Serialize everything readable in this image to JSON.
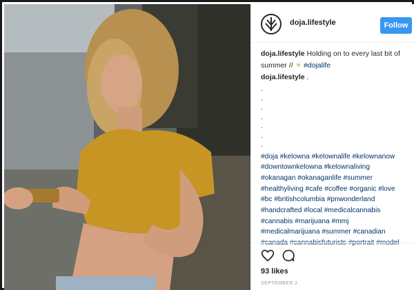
{
  "photo": {
    "description_icon": "photo"
  },
  "post": {
    "username": "doja.lifestyle",
    "follow_label": "Follow",
    "caption": {
      "user": "doja.lifestyle",
      "text_line1": "Holding on to every last bit of",
      "text_line2": "summer //",
      "emoji": "☀",
      "tag": "#dojalife"
    },
    "comment": {
      "user": "doja.lifestyle",
      "text": "."
    },
    "dots": [
      ".",
      ".",
      ".",
      ".",
      ".",
      ".",
      "."
    ],
    "hashtag_lines": [
      "#doja #kelowna #kelownalife #kelownanow",
      "#downtownkelowna #kelownaliving",
      "#okanagan #okanaganlife #summer",
      "#healthyliving #cafe #coffee #organic #love",
      "#bc #britishcolumbia #pnwonderland",
      "#handcrafted #local #medicalcannabis",
      "#cannabis #marijuana #mmj",
      "#medicalmarijuana #summer #canadian",
      "#canada #cannabisfuturists #portrait #model"
    ],
    "likes": "93 likes",
    "date": "SEPTEMBER 2",
    "icons": {
      "heart": "heart-icon",
      "comment": "comment-icon",
      "avatar_logo": "leaf-logo-icon"
    },
    "colors": {
      "follow_button": "#3897f0",
      "hashtag": "#003569",
      "text": "#262626",
      "date": "#999999"
    }
  }
}
